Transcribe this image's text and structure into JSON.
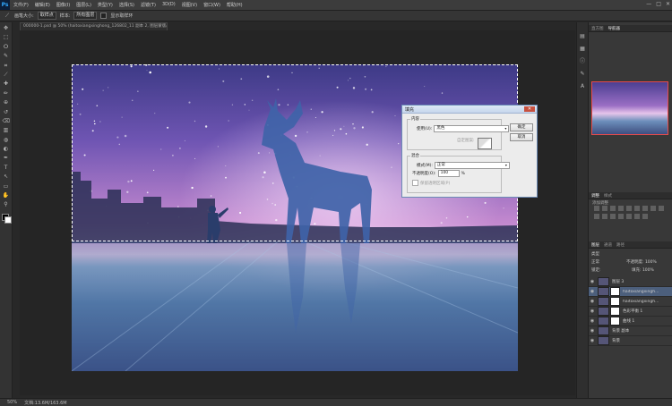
{
  "app": {
    "logo": "Ps"
  },
  "menu": [
    "文件(F)",
    "编辑(E)",
    "图像(I)",
    "图层(L)",
    "类型(Y)",
    "选择(S)",
    "滤镜(T)",
    "3D(D)",
    "视图(V)",
    "窗口(W)",
    "帮助(H)"
  ],
  "window_controls": [
    "—",
    "□",
    "✕"
  ],
  "options": {
    "brush_label": "画笔大小:",
    "sample_select": "取样点",
    "style_label": "样本:",
    "style_select": "所有图层",
    "checkbox_label": "显示取样环"
  },
  "document_tab": "000000-1.psd @ 50% (haitoxiangxinghong_126802_11 副本 2, 图层蒙版/8) *",
  "tools": [
    "move-icon",
    "marquee-icon",
    "lasso-icon",
    "quick-select-icon",
    "crop-icon",
    "eyedropper-icon",
    "healing-icon",
    "brush-icon",
    "stamp-icon",
    "history-brush-icon",
    "eraser-icon",
    "gradient-icon",
    "blur-icon",
    "dodge-icon",
    "pen-icon",
    "text-icon",
    "path-select-icon",
    "shape-icon",
    "hand-icon",
    "zoom-icon"
  ],
  "tool_glyphs": [
    "✥",
    "⬚",
    "ⵔ",
    "✎",
    "⌗",
    "⟋",
    "✚",
    "✏",
    "⊕",
    "↺",
    "⌫",
    "▥",
    "◍",
    "◐",
    "✒",
    "T",
    "↖",
    "▭",
    "✋",
    "⚲"
  ],
  "status": {
    "zoom": "50%",
    "doc": "文档:13.6M/163.6M"
  },
  "dialog": {
    "title": "填充",
    "close": "✕",
    "content_group": "内容",
    "use_label": "使用(U):",
    "use_value": "黑色",
    "custom_pattern": "自定图案:",
    "blend_group": "混合",
    "mode_label": "模式(M):",
    "mode_value": "正常",
    "opacity_label": "不透明度(O):",
    "opacity_value": "100",
    "opacity_unit": "%",
    "preserve_label": "保留透明区域(P)",
    "ok": "确定",
    "cancel": "取消"
  },
  "navigator_tabs": [
    "直方图",
    "导航器"
  ],
  "adjust_tabs": [
    "调整",
    "样式"
  ],
  "adjust_label": "添加调整",
  "layer_tabs": [
    "图层",
    "通道",
    "路径"
  ],
  "layer_kind": "类型",
  "layer_mode": "正常",
  "opacity": "不透明度: 100%",
  "lock_label": "锁定:",
  "fill": "填充: 100%",
  "layers": [
    {
      "name": "图层 3",
      "selected": false
    },
    {
      "name": "haitoxiangxingh...",
      "selected": true,
      "mask": true
    },
    {
      "name": "haitoxiangxingh...",
      "selected": false,
      "mask": true
    },
    {
      "name": "色彩平衡 1",
      "selected": false,
      "mask": true
    },
    {
      "name": "曲线 1",
      "selected": false,
      "mask": true
    },
    {
      "name": "背景 副本",
      "selected": false
    },
    {
      "name": "背景",
      "selected": false
    }
  ],
  "layer_eye": "◉",
  "colors": {
    "selected_layer": "#4c5f7c",
    "accent": "#31a8ff"
  }
}
